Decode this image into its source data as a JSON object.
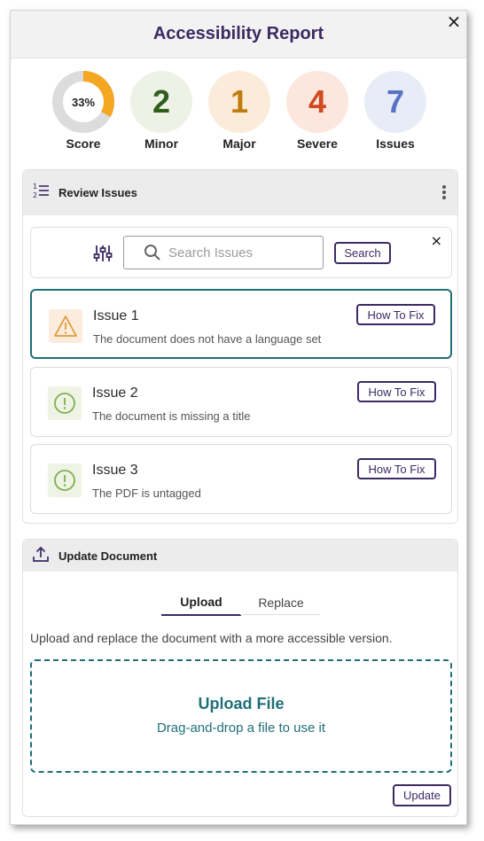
{
  "header": {
    "title": "Accessibility Report",
    "close_icon": "×"
  },
  "stats": {
    "score": {
      "value": "33%",
      "label": "Score",
      "fraction": 0.33,
      "color": "#f5a623",
      "track": "#dcdcdc"
    },
    "minor": {
      "value": "2",
      "label": "Minor",
      "color": "#2e5d1c",
      "bg": "#eef2e6"
    },
    "major": {
      "value": "1",
      "label": "Major",
      "color": "#c07d0d",
      "bg": "#fbecd9"
    },
    "severe": {
      "value": "4",
      "label": "Severe",
      "color": "#cf4a1e",
      "bg": "#fde6dd"
    },
    "issues": {
      "value": "7",
      "label": "Issues",
      "color": "#5a73c4",
      "bg": "#e8ecf7"
    }
  },
  "review": {
    "title": "Review Issues",
    "search_placeholder": "Search Issues",
    "search_button": "Search",
    "clear_icon": "×",
    "items": [
      {
        "title": "Issue 1",
        "description": "The document does not have a language set",
        "fix_label": "How To Fix",
        "icon": "warning-icon",
        "severity_color": "#e29b3a",
        "icon_bg": "#fbecdd"
      },
      {
        "title": "Issue 2",
        "description": "The document is missing a title",
        "fix_label": "How To Fix",
        "icon": "exclamation-circle-icon",
        "severity_color": "#7fb04a",
        "icon_bg": "#eef3e6"
      },
      {
        "title": "Issue 3",
        "description": "The PDF is untagged",
        "fix_label": "How To Fix",
        "icon": "exclamation-circle-icon",
        "severity_color": "#7fb04a",
        "icon_bg": "#eef3e6"
      }
    ]
  },
  "update": {
    "title": "Update Document",
    "tabs": [
      {
        "label": "Upload"
      },
      {
        "label": "Replace"
      }
    ],
    "description": "Upload and replace the document with a more accessible version.",
    "dropzone_title": "Upload File",
    "dropzone_subtitle": "Drag-and-drop a file to use it",
    "update_button": "Update"
  },
  "colors": {
    "brand": "#3b2a63",
    "accent": "#1f6f78"
  }
}
